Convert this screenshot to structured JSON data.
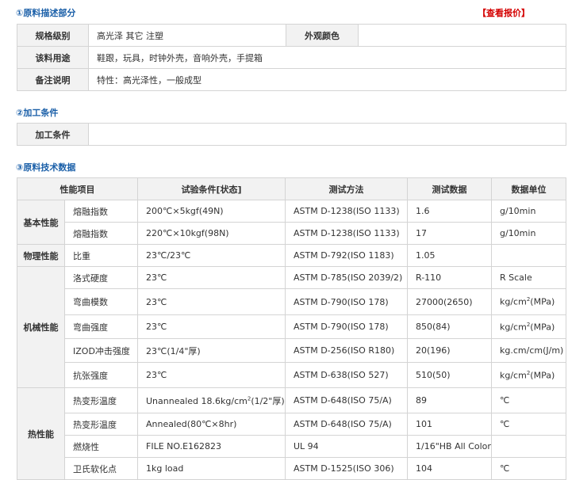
{
  "section1": {
    "title": "①原料描述部分",
    "quote_link": "【查看报价】",
    "rows": {
      "spec_label": "规格级别",
      "spec_value": "高光泽 其它 注塑",
      "color_label": "外观颜色",
      "color_value": "",
      "use_label": "该料用途",
      "use_value": "鞋跟，玩具，时钟外壳，音响外壳，手提箱",
      "note_label": "备注说明",
      "note_value": "特性：高光泽性，一般成型"
    }
  },
  "section2": {
    "title": "②加工条件",
    "label": "加工条件",
    "value": ""
  },
  "section3": {
    "title": "③原料技术数据",
    "headers": [
      "性能项目",
      "试验条件[状态]",
      "测试方法",
      "测试数据",
      "数据单位"
    ],
    "groups": [
      "基本性能",
      "物理性能",
      "机械性能",
      "热性能"
    ],
    "rows": [
      {
        "item": "熔融指数",
        "cond": "200℃×5kgf(49N)",
        "method": "ASTM D-1238(ISO 1133)",
        "value": "1.6",
        "unit": "g/10min"
      },
      {
        "item": "熔融指数",
        "cond": "220℃×10kgf(98N)",
        "method": "ASTM D-1238(ISO 1133)",
        "value": "17",
        "unit": "g/10min"
      },
      {
        "item": "比重",
        "cond": "23℃/23℃",
        "method": "ASTM D-792(ISO 1183)",
        "value": "1.05",
        "unit": ""
      },
      {
        "item": "洛式硬度",
        "cond": "23℃",
        "method": "ASTM D-785(ISO 2039/2)",
        "value": "R-110",
        "unit": "R Scale"
      },
      {
        "item": "弯曲模数",
        "cond": "23℃",
        "method": "ASTM D-790(ISO 178)",
        "value": "27000(2650)",
        "unit_pre": "kg/cm",
        "unit_sup": "2",
        "unit_post": "(MPa)"
      },
      {
        "item": "弯曲强度",
        "cond": "23℃",
        "method": "ASTM D-790(ISO 178)",
        "value": "850(84)",
        "unit_pre": "kg/cm",
        "unit_sup": "2",
        "unit_post": "(MPa)"
      },
      {
        "item": "IZOD冲击强度",
        "cond": "23℃(1/4\"厚)",
        "method": "ASTM D-256(ISO R180)",
        "value": "20(196)",
        "unit": "kg.cm/cm(J/m)"
      },
      {
        "item": "抗张强度",
        "cond": "23℃",
        "method": "ASTM D-638(ISO 527)",
        "value": "510(50)",
        "unit_pre": "kg/cm",
        "unit_sup": "2",
        "unit_post": "(MPa)"
      },
      {
        "item": "热变形温度",
        "cond_pre": "Unannealed 18.6kg/cm",
        "cond_sup": "2",
        "cond_post": "(1/2\"厚)",
        "method": "ASTM D-648(ISO 75/A)",
        "value": "89",
        "unit": "℃"
      },
      {
        "item": "热变形温度",
        "cond": "Annealed(80℃×8hr)",
        "method": "ASTM D-648(ISO 75/A)",
        "value": "101",
        "unit": "℃"
      },
      {
        "item": "燃烧性",
        "cond": "FILE NO.E162823",
        "method": "UL 94",
        "value": "1/16\"HB All Color",
        "unit": ""
      },
      {
        "item": "卫氏软化点",
        "cond": "1kg load",
        "method": "ASTM D-1525(ISO 306)",
        "value": "104",
        "unit": "℃"
      }
    ]
  }
}
